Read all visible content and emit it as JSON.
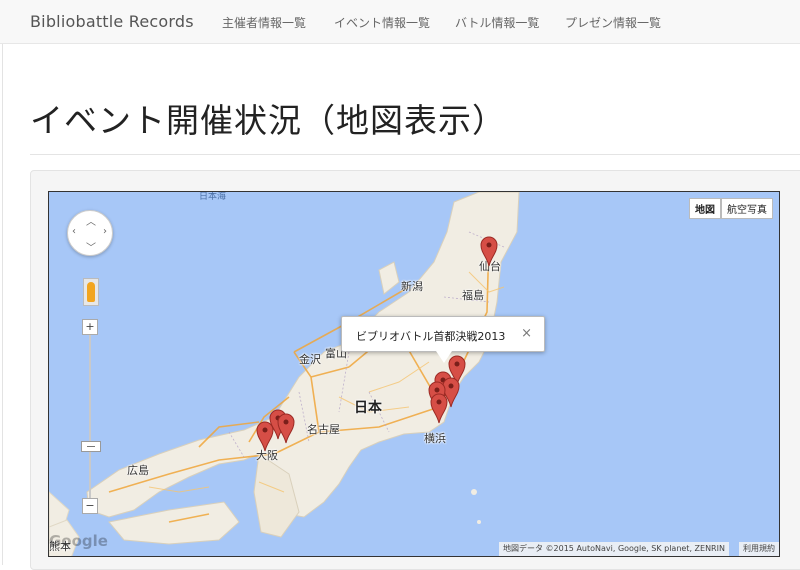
{
  "navbar": {
    "brand": "Bibliobattle Records",
    "items": [
      {
        "label": "主催者情報一覧"
      },
      {
        "label": "イベント情報一覧"
      },
      {
        "label": "バトル情報一覧"
      },
      {
        "label": "プレゼン情報一覧"
      }
    ]
  },
  "page": {
    "title": "イベント開催状況（地図表示）"
  },
  "map": {
    "type_buttons": {
      "map": "地図",
      "satellite": "航空写真"
    },
    "labels": {
      "sea": "日本海",
      "country": "日本",
      "sendai": "仙台",
      "niigata": "新潟",
      "fukushima": "福島",
      "toyama": "富山",
      "kanazawa": "金沢",
      "nagoya": "名古屋",
      "osaka": "大阪",
      "hiroshima": "広島",
      "yokohama": "横浜",
      "kumamoto": "熊本"
    },
    "infowindow": {
      "text": "ビブリオバトル首都決戦2013",
      "close": "×"
    },
    "zoom": {
      "in": "+",
      "out": "−"
    },
    "watermark": "Google",
    "attribution": "地図データ ©2015 AutoNavi, Google, SK planet, ZENRIN",
    "terms": "利用規約",
    "colors": {
      "water": "#a7c7f7",
      "land": "#f1ede3",
      "marker": "#d64e46"
    }
  }
}
